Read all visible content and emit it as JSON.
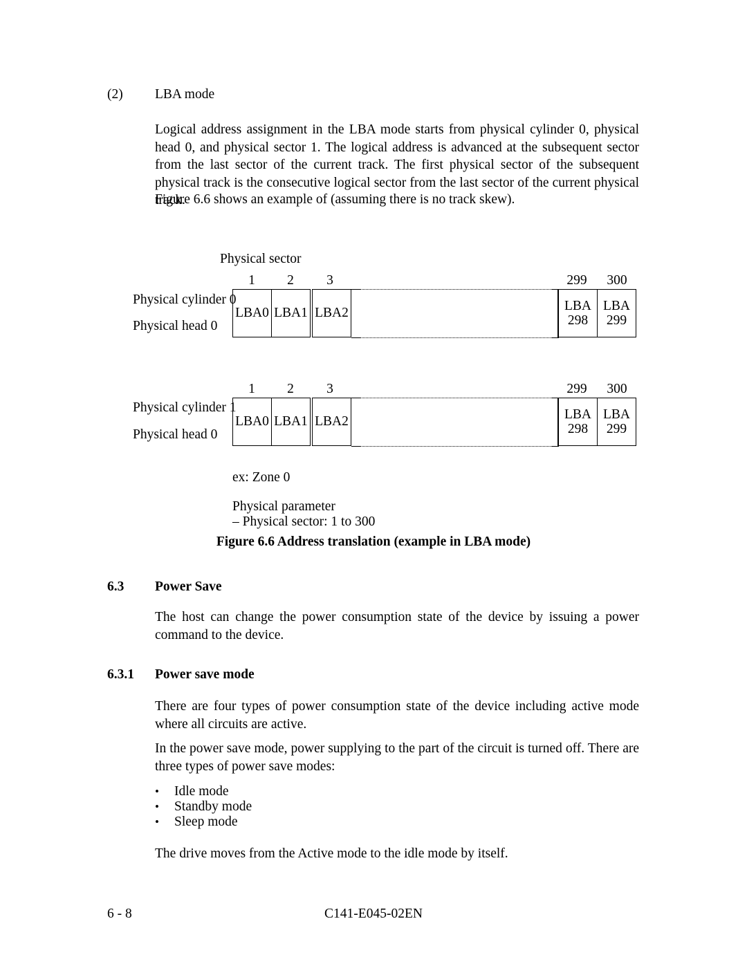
{
  "document": {
    "section_item_number": "(2)",
    "section_item_title": "LBA mode",
    "paragraph_lba_mode": "Logical address assignment in the LBA mode starts from physical cylinder 0, physical head 0, and physical sector 1.  The logical address is advanced at the subsequent sector from the last sector of the current track.  The first physical sector of the subsequent physical track is the consecutive logical sector from the last sector of the current physical track.",
    "paragraph_figure_ref": "Figure 6.6 shows an example of (assuming there is no track skew)."
  },
  "figure": {
    "caption": "Figure 6.6    Address translation (example in LBA mode)",
    "axis_label": "Physical sector",
    "sector_numbers_left": [
      "1",
      "2",
      "3"
    ],
    "sector_numbers_right": [
      "299",
      "300"
    ],
    "tracks": [
      {
        "label_line1": "Physical cylinder 0",
        "label_line2": "Physical head 0",
        "cells_left": [
          "LBA0",
          "LBA1",
          "LBA2"
        ],
        "cells_right": [
          {
            "line1": "LBA",
            "line2": "298"
          },
          {
            "line1": "LBA",
            "line2": "299"
          }
        ]
      },
      {
        "label_line1": "Physical cylinder 1",
        "label_line2": "Physical head 0",
        "cells_left": [
          "LBA0",
          "LBA1",
          "LBA2"
        ],
        "cells_right": [
          {
            "line1": "LBA",
            "line2": "298"
          },
          {
            "line1": "LBA",
            "line2": "299"
          }
        ]
      }
    ],
    "notes": {
      "example": "ex:  Zone 0",
      "parameter_title": "Physical parameter",
      "parameter_line": "– Physical sector:  1 to 300"
    }
  },
  "power_save": {
    "section_number": "6.3",
    "section_title": "Power Save",
    "intro_paragraph": "The host can change the power consumption state of the device by issuing a power command to the device.",
    "subsection_number": "6.3.1",
    "subsection_title": "Power save mode",
    "paragraph_four_types": "There are four types of power consumption state of the device including active mode where all circuits are active.",
    "paragraph_power_save": "In the power save mode, power supplying to the part of the circuit is turned off.  There are three types of power save modes:",
    "bullet_glyph": "•",
    "modes": [
      "Idle mode",
      "Standby mode",
      "Sleep mode"
    ],
    "paragraph_drive_moves": "The drive moves from the Active mode to the idle mode by itself."
  },
  "footer": {
    "page_number": "6 - 8",
    "document_number": "C141-E045-02EN"
  }
}
